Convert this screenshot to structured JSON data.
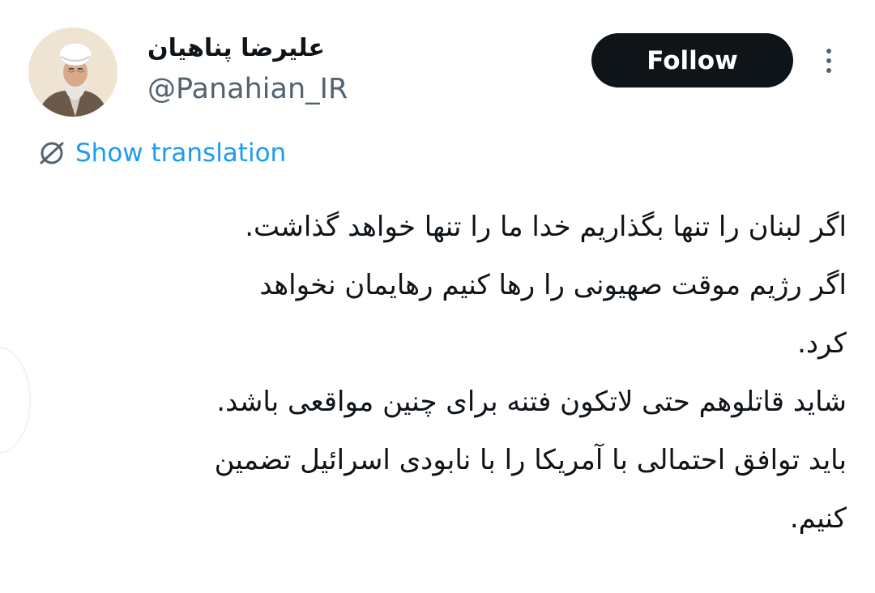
{
  "author": {
    "display_name": "علیرضا پناهیان",
    "handle": "@Panahian_IR",
    "avatar_icon": "profile-photo"
  },
  "actions": {
    "follow_label": "Follow",
    "more_icon": "more-vertical-icon"
  },
  "translation": {
    "icon": "globe-icon",
    "label": "Show translation"
  },
  "tweet": {
    "lines": [
      "اگر لبنان را تنها بگذاریم خدا ما را تنها خواهد گذاشت.",
      "اگر رژیم موقت صهیونی را رها کنیم رهایمان نخواهد",
      "کرد.",
      "شاید قاتلوهم حتی لاتکون فتنه برای چنین مواقعی باشد.",
      "باید توافق احتمالی با آمریکا را با نابودی اسرائیل تضمین",
      "کنیم."
    ]
  },
  "colors": {
    "text_primary": "#0f1419",
    "text_secondary": "#536471",
    "link": "#1d9bf0",
    "button_bg": "#0f1419",
    "button_text": "#ffffff",
    "background": "#ffffff"
  }
}
